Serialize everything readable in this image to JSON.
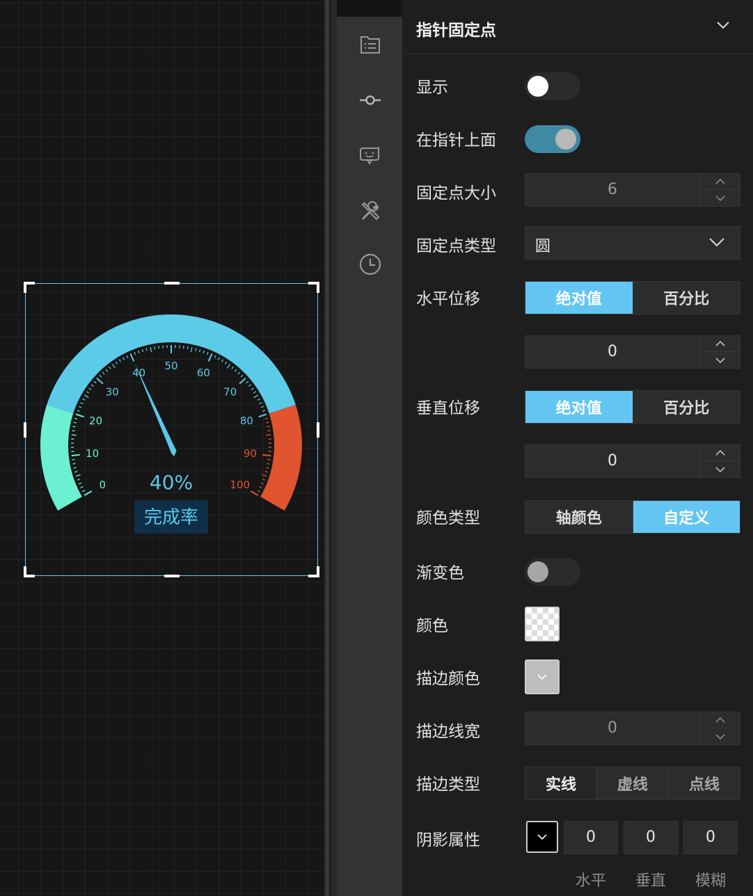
{
  "gauge": {
    "percent_text": "40%",
    "caption": "完成率",
    "value": 40,
    "min": 0,
    "max": 100,
    "tick_labels": [
      "0",
      "10",
      "20",
      "30",
      "40",
      "50",
      "60",
      "70",
      "80",
      "90",
      "100"
    ],
    "colors": {
      "low": "#6cf0d4",
      "mid": "#5ccbe8",
      "high": "#e05430",
      "caption_bg": "#0f2e48"
    },
    "bands": [
      {
        "from": 0,
        "to": 20,
        "color": "#6cf0d4"
      },
      {
        "from": 20,
        "to": 80,
        "color": "#5ccbe8"
      },
      {
        "from": 80,
        "to": 100,
        "color": "#e05430"
      }
    ]
  },
  "iconbar": {
    "icons": [
      "list-icon",
      "pointer-dot-icon",
      "chat-label-icon",
      "tools-icon",
      "clock-icon"
    ]
  },
  "panel": {
    "title": "指针固定点",
    "rows": {
      "show": {
        "label": "显示",
        "on": false
      },
      "on_top": {
        "label": "在指针上面",
        "on": true
      },
      "size": {
        "label": "固定点大小",
        "value": "6"
      },
      "type": {
        "label": "固定点类型",
        "value": "圆"
      },
      "h_offset": {
        "label": "水平位移",
        "options": [
          "绝对值",
          "百分比"
        ],
        "active": 0,
        "value": "0"
      },
      "v_offset": {
        "label": "垂直位移",
        "options": [
          "绝对值",
          "百分比"
        ],
        "active": 0,
        "value": "0"
      },
      "color_type": {
        "label": "颜色类型",
        "options": [
          "轴颜色",
          "自定义"
        ],
        "active": 1
      },
      "gradient": {
        "label": "渐变色",
        "on": false
      },
      "color": {
        "label": "颜色"
      },
      "stroke_color": {
        "label": "描边颜色"
      },
      "stroke_width": {
        "label": "描边线宽",
        "value": "0"
      },
      "stroke_type": {
        "label": "描边类型",
        "options": [
          "实线",
          "虚线",
          "点线"
        ],
        "active": 0
      },
      "shadow": {
        "label": "阴影属性",
        "values": [
          "0",
          "0",
          "0"
        ],
        "captions": [
          "水平",
          "垂直",
          "模糊"
        ]
      }
    }
  }
}
